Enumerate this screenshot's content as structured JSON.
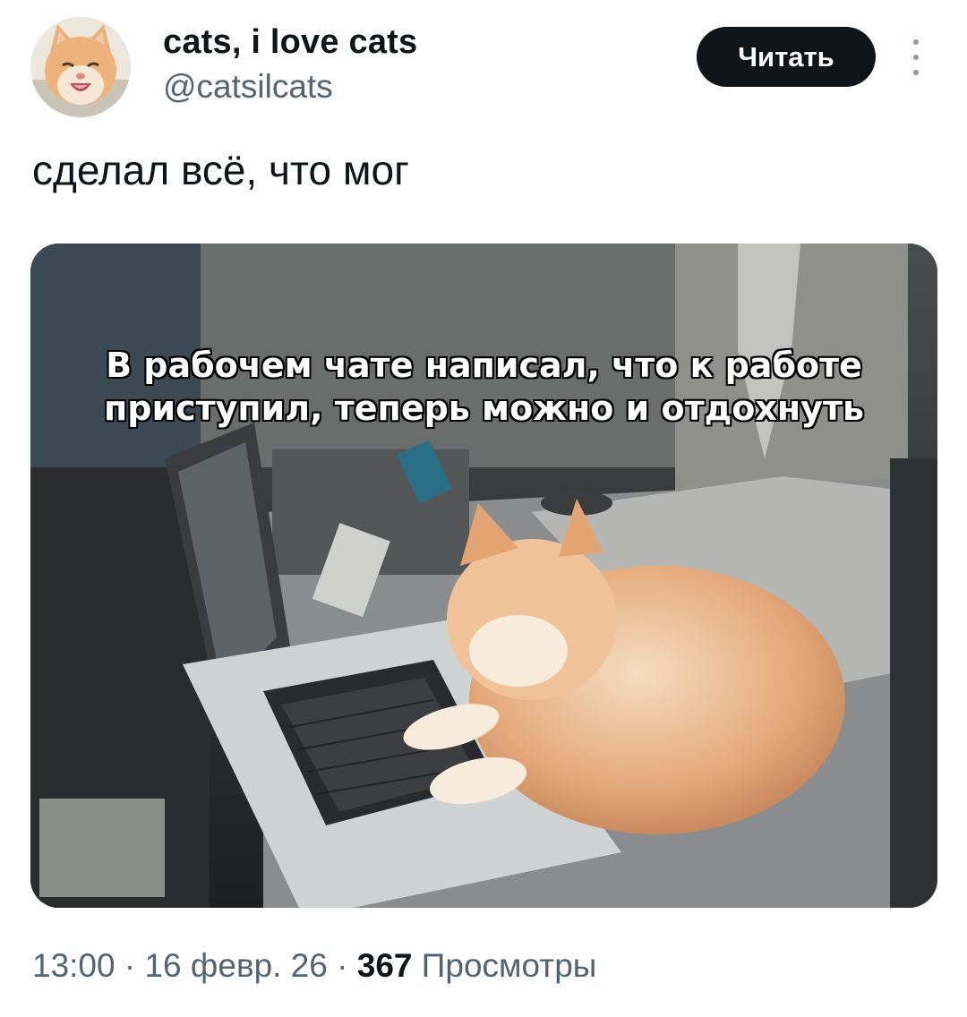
{
  "author": {
    "display_name": "cats, i love cats",
    "handle": "@catsilcats",
    "avatar_icon": "cat-avatar"
  },
  "actions": {
    "follow_label": "Читать",
    "more_icon": "more-vertical-icon"
  },
  "tweet": {
    "text": "сделал всё, что мог"
  },
  "media": {
    "caption_line1": "В рабочем чате написал, что к работе",
    "caption_line2": "приступил, теперь можно и отдохнуть"
  },
  "meta": {
    "time": "13:00",
    "separator1": " · ",
    "date": "16 февр. 26",
    "separator2": " · ",
    "views_count": "367",
    "views_label": "Просмотры"
  },
  "colors": {
    "text_primary": "#0f1419",
    "text_secondary": "#536471",
    "button_bg": "#0f1419",
    "button_text": "#ffffff"
  }
}
